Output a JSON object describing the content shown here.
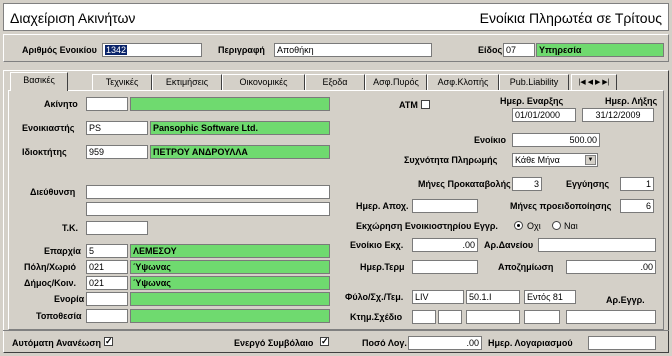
{
  "title": {
    "left": "Διαχείριση Ακινήτων",
    "right": "Ενοίκια Πληρωτέα σε Τρίτους"
  },
  "header": {
    "rental_no_label": "Αριθμός Ενοικίου",
    "rental_no_value": "1342",
    "description_label": "Περιγραφή",
    "description_value": "Αποθήκη",
    "type_label": "Είδος",
    "type_code": "07",
    "type_name": "Υπηρεσία"
  },
  "tabs": [
    "Βασικές",
    "Τεχνικές",
    "Εκτιμήσεις",
    "Οικονομικές",
    "Εξοδα",
    "Ασφ.Πυρός",
    "Ασφ.Κλοπής",
    "Pub.Liability"
  ],
  "tab_nav": "|◀ ◀ ▶ ▶|",
  "left": {
    "property_label": "Ακίνητο",
    "property_code": "",
    "property_name": "",
    "tenant_label": "Ενοικιαστής",
    "tenant_code": "PS",
    "tenant_name": "Pansophic Software Ltd.",
    "owner_label": "Ιδιοκτήτης",
    "owner_code": "959",
    "owner_name": "ΠΕΤΡΟΥ ΑΝΔΡΟΥΛΛΑ",
    "address_label": "Διεύθυνση",
    "address_1": "",
    "address_2": "",
    "tk_label": "Τ.Κ.",
    "tk_value": "",
    "district_label": "Επαρχία",
    "district_code": "5",
    "district_name": "ΛΕΜΕΣΟΥ",
    "city_label": "Πόλη/Χωριό",
    "city_code": "021",
    "city_name": "Ύψωνας",
    "municipality_label": "Δήμος/Κοιν.",
    "municipality_code": "021",
    "municipality_name": "Ύψωνας",
    "parish_label": "Ενορία",
    "parish_code": "",
    "parish_name": "",
    "location_label": "Τοποθεσία",
    "location_code": "",
    "location_name": ""
  },
  "right": {
    "atm_label": "ATM",
    "start_label": "Ημερ. Εναρξης",
    "start_value": "01/01/2000",
    "end_label": "Ημερ. Λήξης",
    "end_value": "31/12/2009",
    "rent_label": "Ενοίκιο",
    "rent_value": "500.00",
    "freq_label": "Συχνότητα Πληρωμής",
    "freq_value": "Κάθε Μήνα",
    "advance_label": "Μήνες Προκαταβολής",
    "advance_value": "3",
    "guarantee_label": "Εγγύησης",
    "guarantee_value": "1",
    "withdraw_date_label": "Ημερ. Αποχ.",
    "withdraw_date_value": "",
    "notice_label": "Μήνες προειδοποίησης",
    "notice_value": "6",
    "assign_label": "Εκχώρηση Ενοικιοστηρίου Εγγρ.",
    "assign_no": "Οχι",
    "assign_yes": "Ναι",
    "rent_coll_label": "Ενοίκιο Εκχ.",
    "rent_coll_value": ".00",
    "receipt_label": "Αρ.Δανείου",
    "receipt_value": "",
    "date_term_label": "Ημερ.Τερμ",
    "date_term_value": "",
    "compensation_label": "Αποζημίωση",
    "compensation_value": ".00",
    "sheet_label": "Φύλο/Σχ./Τεμ.",
    "sheet_1": "LIV",
    "sheet_2": "50.1.I",
    "sheet_3": "Εντός 81",
    "reg_no_label": "Αρ.Εγγρ.",
    "plan_label": "Κτημ.Σχέδιο"
  },
  "bottom": {
    "auto_renew_label": "Αυτόματη Ανανέωση",
    "active_label": "Ενεργό Συμβόλαιο",
    "amount_label": "Ποσό Λογ.",
    "amount_value": ".00",
    "account_date_label": "Ημερ. Λογαριασμού",
    "account_date_value": ""
  }
}
